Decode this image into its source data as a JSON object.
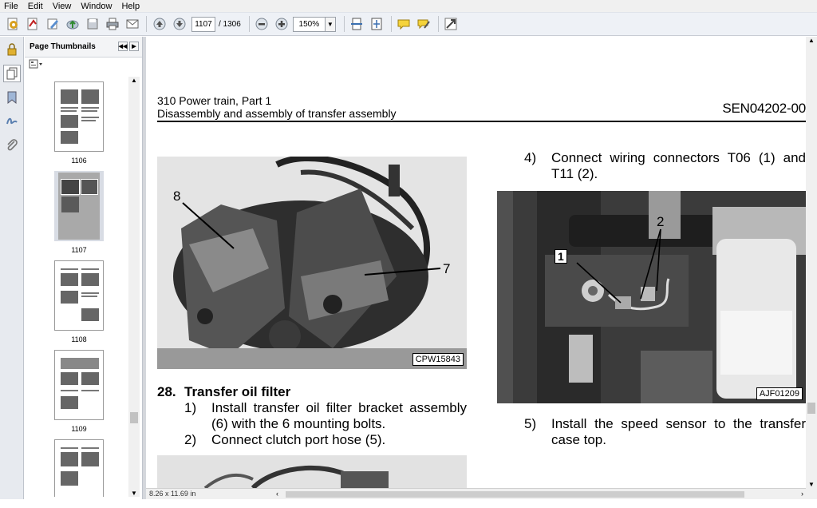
{
  "menu": [
    "File",
    "Edit",
    "View",
    "Window",
    "Help"
  ],
  "toolbar": {
    "current_page": "1107",
    "total_pages": "/ 1306",
    "zoom": "150%"
  },
  "thumbnails": {
    "title": "Page Thumbnails",
    "pages": [
      "1106",
      "1107",
      "1108",
      "1109"
    ]
  },
  "status": {
    "page_size": "8.26 x 11.69 in"
  },
  "document": {
    "header_line1": "310 Power train, Part 1",
    "header_line2": "Disassembly and assembly of transfer assembly",
    "doc_code": "SEN04202-00",
    "photo1": {
      "code": "CPW15843",
      "label_a": "8",
      "label_b": "7"
    },
    "photo2": {
      "code": "AJF01209",
      "label_a": "1",
      "label_b": "2"
    },
    "section": {
      "number": "28.",
      "title": "Transfer oil filter"
    },
    "steps": [
      {
        "number": "1)",
        "text": "Install transfer oil filter bracket assembly (6) with the 6 mounting bolts."
      },
      {
        "number": "2)",
        "text": "Connect clutch port hose (5)."
      },
      {
        "number": "4)",
        "text": "Connect wiring connectors T06 (1) and T11 (2)."
      },
      {
        "number": "5)",
        "text": "Install the speed sensor to the transfer case top."
      }
    ]
  }
}
